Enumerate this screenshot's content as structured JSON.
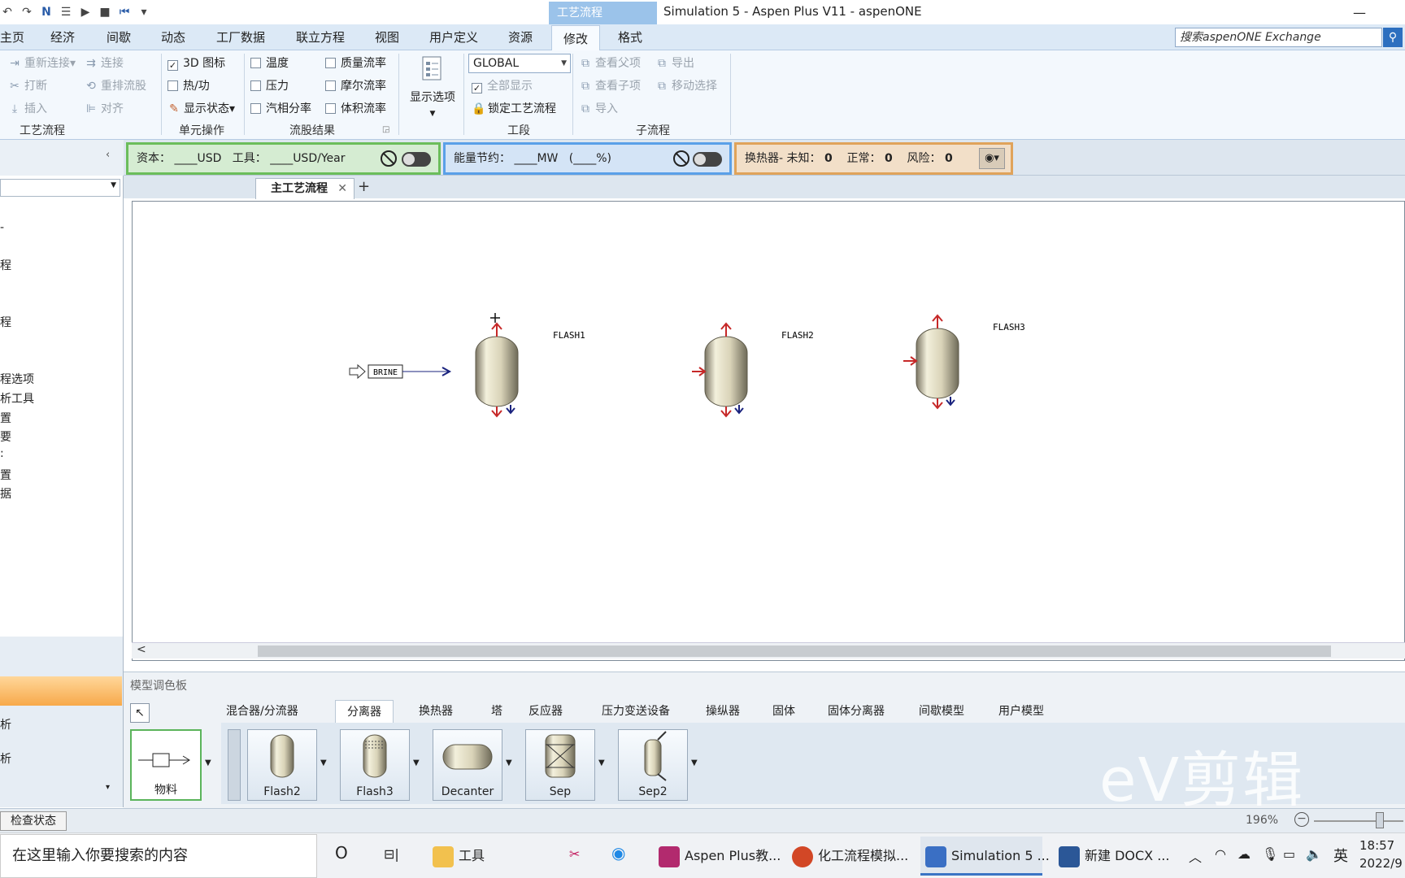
{
  "window": {
    "title": "Simulation 5 - Aspen Plus V11 - aspenONE",
    "context_tab": "工艺流程",
    "minimize": "—"
  },
  "quick_access": [
    "↶",
    "↷",
    "N",
    "☰",
    "▶",
    "■",
    "⏮",
    "▾"
  ],
  "ribbon_tabs": [
    "主页",
    "经济",
    "间歇",
    "动态",
    "工厂数据",
    "联立方程",
    "视图",
    "用户定义",
    "资源",
    "修改",
    "格式"
  ],
  "active_tab": "修改",
  "search": {
    "value": "搜索aspenONE Exchange",
    "button_icon": "search-icon"
  },
  "ribbon": {
    "flowsheet_group": {
      "label": "工艺流程",
      "reconnect": "重新连接",
      "connect": "连接",
      "break": "打断",
      "reroute": "重排流股",
      "insert": "插入",
      "align": "对齐"
    },
    "unit_ops_group": {
      "label": "单元操作",
      "icon_3d": "3D 图标",
      "icon_3d_checked": true,
      "heat_work": "热/功",
      "show_status": "显示状态"
    },
    "stream_results_group": {
      "label": "流股结果",
      "temperature": "温度",
      "mass_flow": "质量流率",
      "pressure": "压力",
      "mole_flow": "摩尔流率",
      "vapor_fraction": "汽相分率",
      "volume_flow": "体积流率"
    },
    "display_options": "显示选项",
    "section_group": {
      "label": "工段",
      "combo_value": "GLOBAL",
      "show_all": "全部显示",
      "show_all_checked": true,
      "lock": "锁定工艺流程"
    },
    "hierarchy_group": {
      "label": "子流程",
      "view_parent": "查看父项",
      "export": "导出",
      "view_child": "查看子项",
      "move_selection": "移动选择",
      "import": "导入"
    }
  },
  "strip": {
    "capital": "资本：",
    "capital_unit": "____USD",
    "utility": "工具：",
    "utility_unit": "____USD/Year",
    "energy": "能量节约：",
    "energy_unit": "____MW",
    "energy_pct": "(____%)",
    "hx": "换热器- 未知：",
    "hx_unknown": "0",
    "hx_ok_label": "正常：",
    "hx_ok": "0",
    "hx_risk_label": "风险：",
    "hx_risk": "0"
  },
  "left_panel": {
    "collapse": "‹",
    "tree_items": [
      "-",
      "程",
      "程",
      "程选项",
      "析工具",
      "置",
      "要",
      ":",
      "置",
      "据"
    ],
    "bottom_items": [
      "析",
      "析"
    ]
  },
  "flowsheet": {
    "tab_label": "主工艺流程",
    "tab_close": "✕",
    "add_tab": "+",
    "blocks": [
      "FLASH1",
      "FLASH2",
      "FLASH3"
    ],
    "stream_label": "BRINE"
  },
  "palette": {
    "title": "模型调色板",
    "tabs": [
      "混合器/分流器",
      "分离器",
      "换热器",
      "塔",
      "反应器",
      "压力变送设备",
      "操纵器",
      "固体",
      "固体分离器",
      "间歇模型",
      "用户模型"
    ],
    "active_tab": "分离器",
    "stream_button": "物料",
    "models": [
      "Flash2",
      "Flash3",
      "Decanter",
      "Sep",
      "Sep2"
    ]
  },
  "watermark": "eV剪辑",
  "statusbar": {
    "check_status": "检查状态",
    "zoom": "196%"
  },
  "taskbar": {
    "search_placeholder": "在这里输入你要搜索的内容",
    "cortana": "O",
    "task_view": "⊟|",
    "folder": "工具",
    "apps": [
      {
        "label": "Aspen Plus教...",
        "color": "#b22a6e"
      },
      {
        "label": "化工流程模拟...",
        "color": "#d24726"
      },
      {
        "label": "Simulation 5 ...",
        "color": "#3a6fc4"
      },
      {
        "label": "新建 DOCX ...",
        "color": "#2b5797"
      }
    ],
    "ime": "英",
    "time": "18:57",
    "date": "2022/9"
  },
  "colors": {
    "accent": "#3a74c4",
    "inlet_arrow": "#c62828",
    "outlet_arrow": "#1a237e"
  }
}
